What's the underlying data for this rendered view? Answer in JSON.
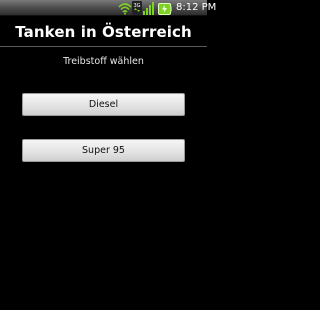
{
  "status_bar": {
    "time": "8:12 PM",
    "network_label": "3G",
    "icons": [
      "wifi-icon",
      "3g-icon",
      "signal-icon",
      "battery-charging-icon"
    ]
  },
  "app": {
    "title": "Tanken in Österreich"
  },
  "main": {
    "subtitle": "Treibstoff wählen",
    "buttons": [
      {
        "label": "Diesel"
      },
      {
        "label": "Super 95"
      }
    ]
  },
  "colors": {
    "background": "#000000",
    "button_face": "#e6e6e6",
    "battery_accent": "#7ed321"
  }
}
